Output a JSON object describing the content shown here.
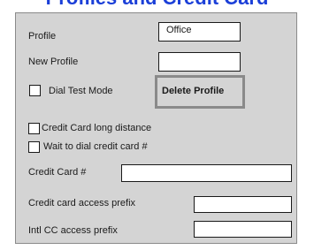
{
  "window": {
    "title": "Profiles and Credit Card"
  },
  "profile": {
    "label": "Profile",
    "value": "Office"
  },
  "new_profile": {
    "label": "New Profile",
    "value": ""
  },
  "dial_test_mode": {
    "label": "Dial Test Mode",
    "checked": false
  },
  "delete_profile": {
    "label": "Delete Profile"
  },
  "credit_card_long_distance": {
    "label": "Credit Card long distance",
    "checked": false
  },
  "wait_to_dial": {
    "label": "Wait to dial credit card #",
    "checked": false
  },
  "credit_card_number": {
    "label": "Credit Card #",
    "value": ""
  },
  "access_prefix": {
    "label": "Credit card access prefix",
    "value": ""
  },
  "intl_prefix": {
    "label": "Intl CC access prefix",
    "value": ""
  }
}
